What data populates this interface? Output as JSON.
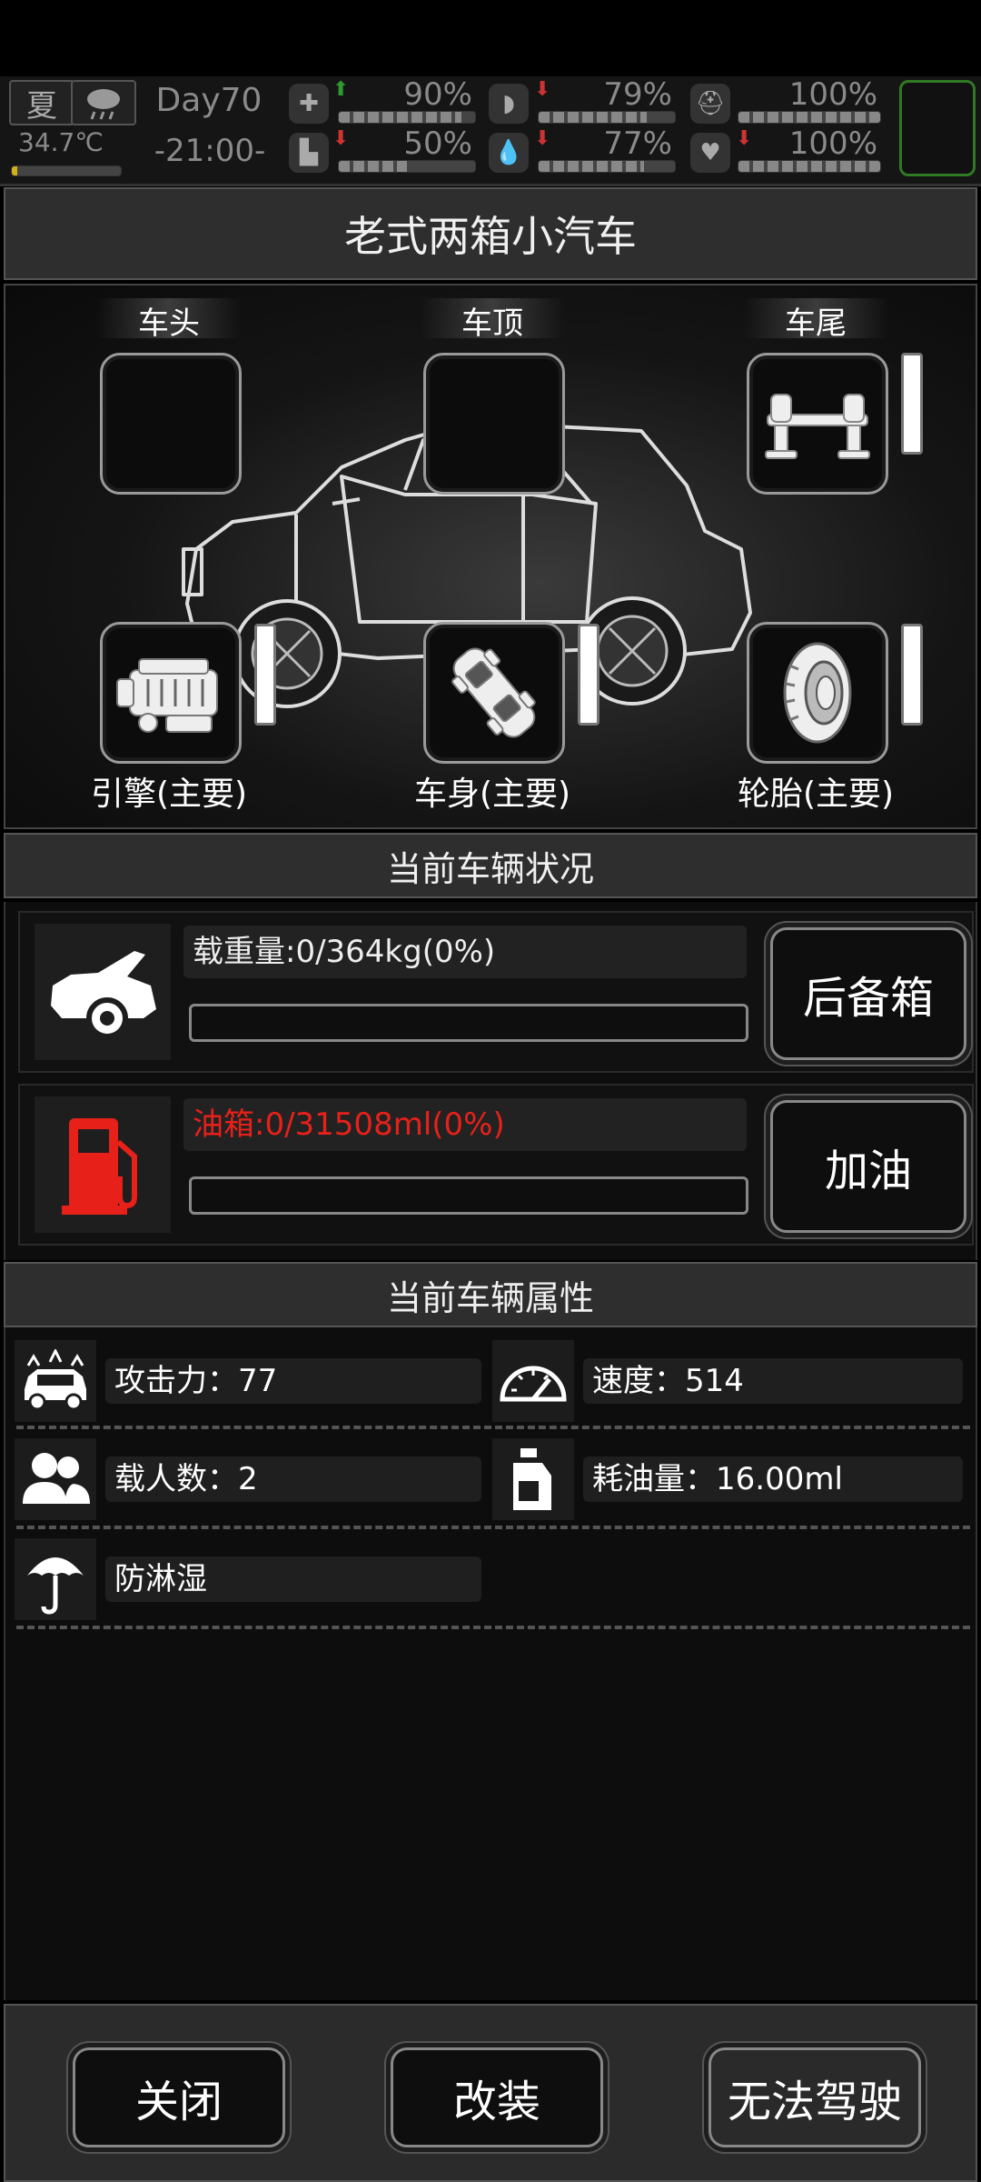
{
  "status": {
    "season": "夏",
    "weather_icon": "cloud-rain-icon",
    "temperature": "34.7℃",
    "temperature_level": 0.05,
    "day": "Day70",
    "time": "-21:00-",
    "stats": [
      {
        "name": "health",
        "icon": "medkit-icon",
        "trend": "up",
        "value": "90%",
        "level": 0.9
      },
      {
        "name": "hunger",
        "icon": "stomach-icon",
        "trend": "down",
        "value": "79%",
        "level": 0.79
      },
      {
        "name": "armor",
        "icon": "helmet-icon",
        "trend": "none",
        "value": "100%",
        "level": 1.0
      },
      {
        "name": "stamina",
        "icon": "boot-icon",
        "trend": "down",
        "value": "50%",
        "level": 0.5
      },
      {
        "name": "thirst",
        "icon": "water-drop-icon",
        "trend": "down",
        "value": "77%",
        "level": 0.77
      },
      {
        "name": "mood",
        "icon": "heart-icon",
        "trend": "down",
        "value": "100%",
        "level": 1.0
      }
    ]
  },
  "vehicle": {
    "title": "老式两箱小汽车",
    "slots": {
      "front": "车头",
      "roof": "车顶",
      "rear": "车尾"
    },
    "parts": {
      "engine": "引擎(主要)",
      "body": "车身(主要)",
      "tire": "轮胎(主要)"
    }
  },
  "condition": {
    "title": "当前车辆状况",
    "load_text": "载重量:0/364kg(0%)",
    "load_level": 0.0,
    "trunk_button": "后备箱",
    "fuel_text": "油箱:0/31508ml(0%)",
    "fuel_level": 0.0,
    "fuel_color": "#e8201a",
    "refuel_button": "加油"
  },
  "attributes": {
    "title": "当前车辆属性",
    "attack": "攻击力：77",
    "speed": "速度：514",
    "passengers": "载人数：2",
    "fuel_use": "耗油量：16.00ml",
    "rainproof": "防淋湿"
  },
  "footer": {
    "close": "关闭",
    "modify": "改装",
    "drive": "无法驾驶"
  }
}
